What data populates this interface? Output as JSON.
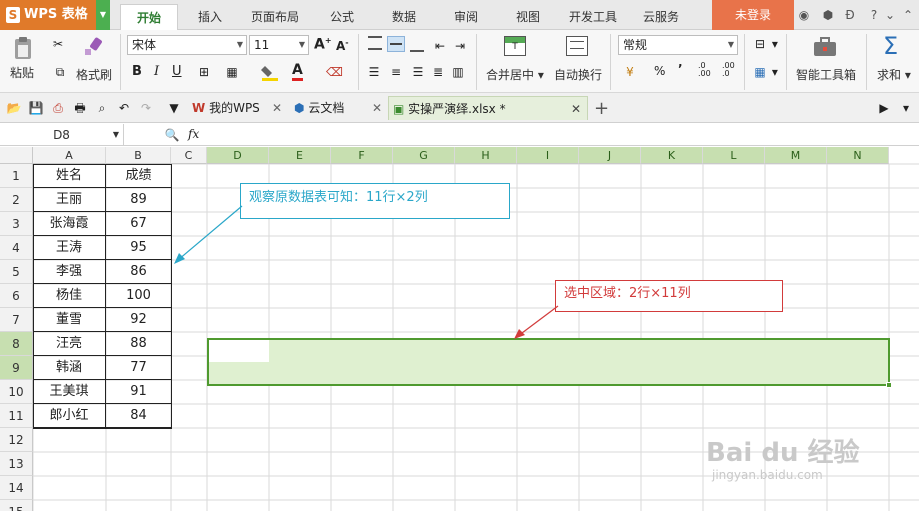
{
  "app": {
    "logo_letter": "S",
    "name": "WPS 表格",
    "login": "未登录"
  },
  "menu": {
    "tabs": [
      "开始",
      "插入",
      "页面布局",
      "公式",
      "数据",
      "审阅",
      "视图",
      "开发工具",
      "云服务"
    ]
  },
  "ribbon": {
    "paste": "粘贴",
    "format_painter": "格式刷",
    "font_name": "宋体",
    "font_size": "11",
    "bold": "B",
    "italic": "I",
    "underline": "U",
    "font_color_letter": "A",
    "merge_center": "合并居中",
    "wrap_text": "自动换行",
    "number_format": "常规",
    "percent": "%",
    "thousands": "’",
    "inc_decimal": ".0\n.00",
    "dec_decimal": ".00\n.0",
    "toolbox": "智能工具箱",
    "sum": "求和",
    "sigma": "Σ"
  },
  "tabs": [
    {
      "label": "我的WPS",
      "icon": "wps-icon"
    },
    {
      "label": "云文档",
      "icon": "cloud-doc-icon"
    },
    {
      "label": "实操严演绎.xlsx *",
      "icon": "sheet-file-icon"
    }
  ],
  "new_tab": "+",
  "formula": {
    "cell_ref": "D8",
    "fx": "fx"
  },
  "columns": [
    "A",
    "B",
    "C",
    "D",
    "E",
    "F",
    "G",
    "H",
    "I",
    "J",
    "K",
    "L",
    "M",
    "N"
  ],
  "rows": [
    "1",
    "2",
    "3",
    "4",
    "5",
    "6",
    "7",
    "8",
    "9",
    "10",
    "11",
    "12",
    "13",
    "14",
    "15"
  ],
  "table": {
    "header": [
      "姓名",
      "成绩"
    ],
    "rows": [
      [
        "王丽",
        "89"
      ],
      [
        "张海霞",
        "67"
      ],
      [
        "王涛",
        "95"
      ],
      [
        "李强",
        "86"
      ],
      [
        "杨佳",
        "100"
      ],
      [
        "董雪",
        "92"
      ],
      [
        "汪亮",
        "88"
      ],
      [
        "韩涵",
        "77"
      ],
      [
        "王美琪",
        "91"
      ],
      [
        "郎小红",
        "84"
      ]
    ]
  },
  "callouts": {
    "source": "观察原数据表可知：11行×2列",
    "selection": "选中区域：2行×11列"
  },
  "watermark": {
    "text": "Bai du 经验",
    "url": "jingyan.baidu.com"
  },
  "colors": {
    "brand_orange": "#e07a2a",
    "accent_green": "#4caf50",
    "selection_fill": "#dff0d0",
    "selection_border": "#4f9a2f",
    "callout_blue": "#2aa7c9",
    "callout_red": "#d23b3b"
  }
}
